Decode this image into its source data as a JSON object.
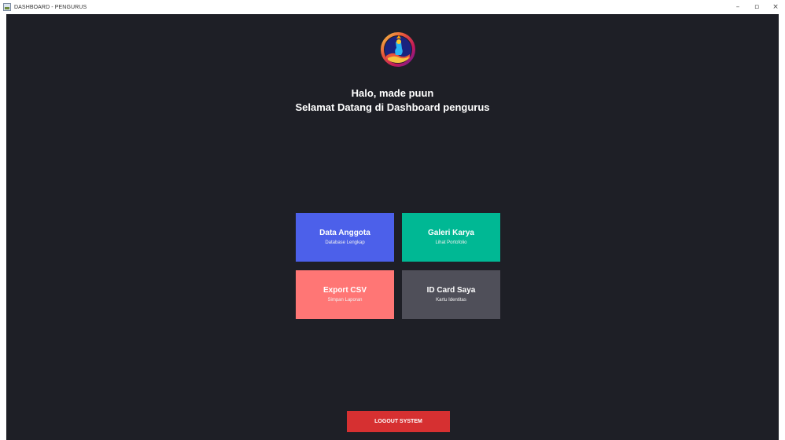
{
  "window": {
    "title": "DASHBOARD - PENGURUS",
    "minimize_glyph": "–",
    "maximize_glyph": "▫",
    "close_glyph": "×"
  },
  "header": {
    "logo_icon": "kecak-dancer-logo-icon",
    "greeting": "Halo, made puun",
    "welcome": "Selamat Datang di Dashboard pengurus"
  },
  "menu": {
    "data_anggota": {
      "title": "Data Anggota",
      "subtitle": "Database Lengkap",
      "color": "#4c60ea"
    },
    "galeri_karya": {
      "title": "Galeri Karya",
      "subtitle": "Lihat Portofolio",
      "color": "#00b894"
    },
    "export_csv": {
      "title": "Export CSV",
      "subtitle": "Simpan Laporan",
      "color": "#ff7675"
    },
    "id_card": {
      "title": "ID Card Saya",
      "subtitle": "Kartu Identitas",
      "color": "#4f4f59"
    }
  },
  "footer": {
    "logout_label": "LOGOUT SYSTEM",
    "logout_color": "#d63031"
  },
  "theme": {
    "background": "#1e1f26",
    "text": "#ffffff"
  }
}
